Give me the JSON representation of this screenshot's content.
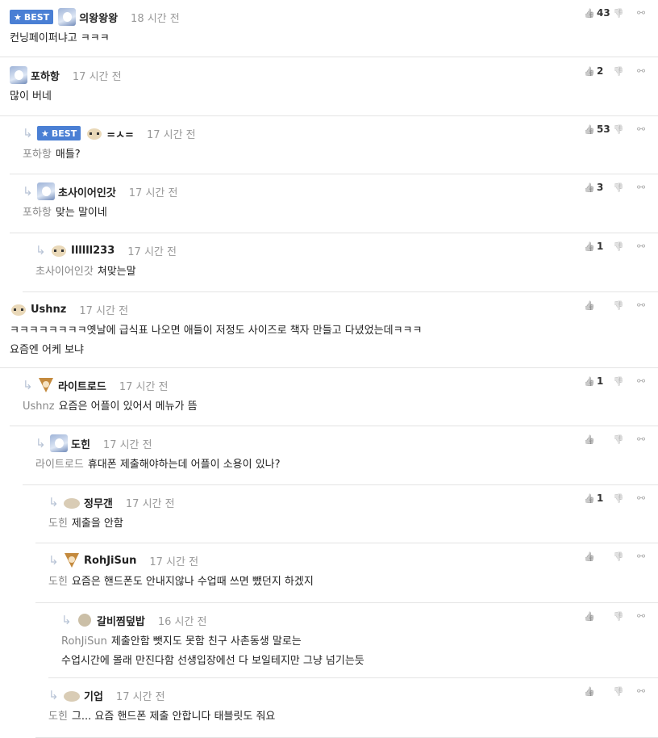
{
  "comments": [
    {
      "best": true,
      "nick": "의왕왕왕",
      "time": "18 시간 전",
      "mention": "",
      "lines": [
        "컨닝페이퍼냐고 ㅋㅋㅋ",
        ""
      ],
      "up": "43"
    },
    {
      "best": false,
      "nick": "포하항",
      "time": "17 시간 전",
      "mention": "",
      "lines": [
        "많이 버네",
        ""
      ],
      "up": "2"
    },
    {
      "best": true,
      "nick": "=ㅅ=",
      "time": "17 시간 전",
      "mention": "포하항",
      "lines": [
        "매틀?",
        ""
      ],
      "up": "53"
    },
    {
      "best": false,
      "nick": "초사이어인갓",
      "time": "17 시간 전",
      "mention": "포하항",
      "lines": [
        "맞는 말이네",
        ""
      ],
      "up": "3"
    },
    {
      "best": false,
      "nick": "Illlll233",
      "time": "17 시간 전",
      "mention": "초사이어인갓",
      "lines": [
        "쳐맞는말",
        ""
      ],
      "up": "1"
    },
    {
      "best": false,
      "nick": "Ushnz",
      "time": "17 시간 전",
      "mention": "",
      "lines": [
        "ㅋㅋㅋㅋㅋㅋㅋㅋ옛날에 급식표 나오면 애들이 저정도 사이즈로 책자 만들고 다녔었는데ㅋㅋㅋ",
        "요즘엔 어케 보냐"
      ],
      "up": ""
    },
    {
      "best": false,
      "nick": "라이트로드",
      "time": "17 시간 전",
      "mention": "Ushnz",
      "lines": [
        "요즘은 어플이 있어서 메뉴가 뜸",
        ""
      ],
      "up": "1"
    },
    {
      "best": false,
      "nick": "도힌",
      "time": "17 시간 전",
      "mention": "라이트로드",
      "lines": [
        "휴대폰 제출해야하는데 어플이 소용이 있나?",
        ""
      ],
      "up": ""
    },
    {
      "best": false,
      "nick": "정무갠",
      "time": "17 시간 전",
      "mention": "도힌",
      "lines": [
        "제출을 안함",
        ""
      ],
      "up": "1"
    },
    {
      "best": false,
      "nick": "RohJiSun",
      "time": "17 시간 전",
      "mention": "도힌",
      "lines": [
        "요즘은 핸드폰도 안내지않나 수업때 쓰면 뺐던지 하겠지",
        ""
      ],
      "up": ""
    },
    {
      "best": false,
      "nick": "갈비찜덮밥",
      "time": "16 시간 전",
      "mention": "RohJiSun",
      "lines": [
        "제출안함 뺏지도 못함 친구 사촌동생 말로는",
        "수업시간에 몰래 만진다함 선생입장에선 다 보일테지만 그냥 넘기는듯"
      ],
      "up": ""
    },
    {
      "best": false,
      "nick": "기업",
      "time": "17 시간 전",
      "mention": "도힌",
      "lines": [
        "그... 요즘 핸드폰 제출 안합니다 태블릿도 줘요",
        ""
      ],
      "up": ""
    }
  ],
  "labels": {
    "best": "BEST"
  },
  "icons": {
    "up": "thumbs-up-icon",
    "down": "thumbs-down-icon",
    "link": "link-icon",
    "reply": "reply-arrow-icon"
  }
}
